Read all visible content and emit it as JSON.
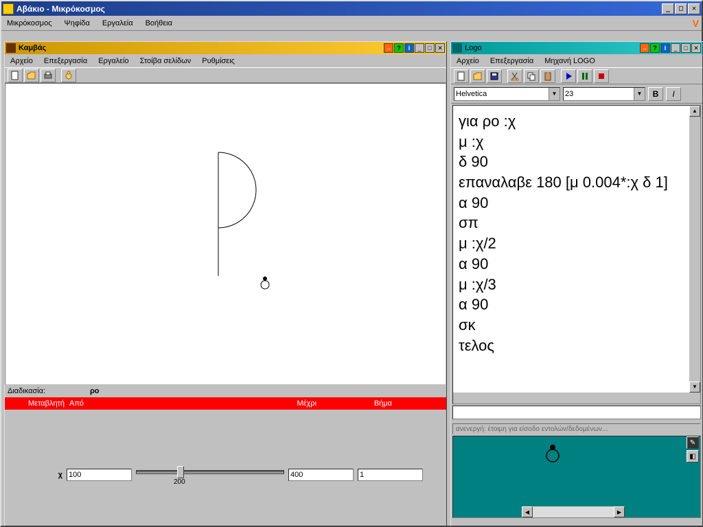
{
  "app": {
    "title": "Αβάκιο - Μικρόκοσμος"
  },
  "main_menu": [
    "Μικρόκοσμος",
    "Ψηφίδα",
    "Εργαλεία",
    "Βοήθεια"
  ],
  "canvas": {
    "title": "Καμβάς",
    "menu": [
      "Αρχείο",
      "Επεξεργασία",
      "Εργαλείο",
      "Στοίβα σελίδων",
      "Ρυθμίσεις"
    ]
  },
  "proc": {
    "label": "Διαδικασία:",
    "value": "ρο",
    "cols": {
      "var": "Μεταβλητή",
      "from": "Από",
      "to": "Μέχρι",
      "step": "Βήμα"
    },
    "var_name": "χ",
    "from_val": "100",
    "tick_label": "200",
    "to_val": "400",
    "step_val": "1"
  },
  "logo": {
    "title": "Logo",
    "menu": [
      "Αρχείο",
      "Επεξεργασία",
      "Μηχανή LOGO"
    ],
    "font": "Helvetica",
    "fontsize": "23",
    "bold_label": "B",
    "italic_label": "I",
    "code": "για ρο :χ\nμ :χ\nδ 90\nεπαναλαβε 180 [μ 0.004*:χ δ 1]\nα 90\nσπ\nμ :χ/2\nα 90\nμ :χ/3\nα 90\nσκ\nτελος",
    "status": "ανενεργή: έτοιμη για είσοδο εντολών/δεδομένων..."
  }
}
